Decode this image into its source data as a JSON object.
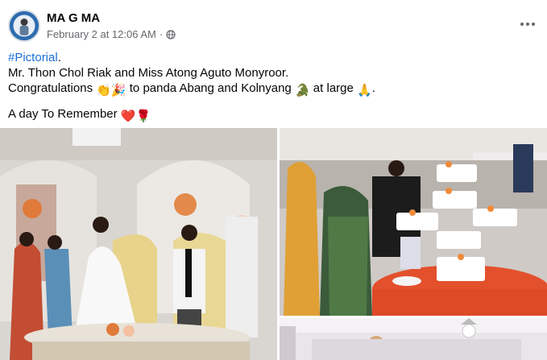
{
  "post": {
    "author": "MA G MA",
    "timestamp": "February 2 at 12:06 AM",
    "separator": "·",
    "privacy_icon": "globe-icon",
    "more_icon": "more-horizontal-icon",
    "hashtag": "#Pictorial",
    "hashtag_suffix": ".",
    "line2": "Mr. Thon Chol Riak and Miss Atong Aguto Monyroor.",
    "line3_part1": "Congratulations ",
    "line3_emoji1": "👏🎉",
    "line3_part2": " to panda Abang and Kolnyang ",
    "line3_emoji2": "🐊",
    "line3_part3": " at large ",
    "line3_emoji3": "🙏",
    "line3_part4": ".",
    "line4": "A day To Remember ",
    "line4_emoji": "❤️🌹"
  },
  "photos": [
    {
      "name": "wedding-couple-photo"
    },
    {
      "name": "wedding-cake-photo"
    },
    {
      "name": "reception-hall-photo"
    }
  ]
}
